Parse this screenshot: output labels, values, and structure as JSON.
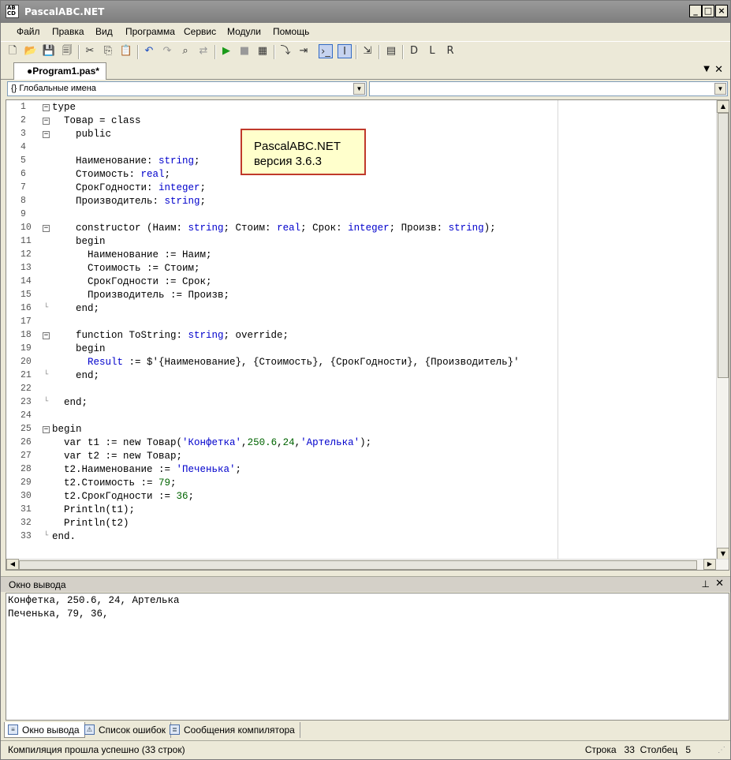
{
  "window": {
    "title": "PascalABC.NET",
    "icon_text": "AB\nCD"
  },
  "menu": [
    "Файл",
    "Правка",
    "Вид",
    "Программа",
    "Сервис",
    "Модули",
    "Помощь"
  ],
  "document_tab": "●Program1.pas*",
  "scope_combo": {
    "value": "Глобальные имена",
    "prefix": "{}"
  },
  "callout": {
    "line1": "PascalABC.NET",
    "line2": "версия 3.6.3"
  },
  "code_lines": [
    [
      [
        "type",
        "kw"
      ]
    ],
    [
      [
        "  Товар = class",
        "kw"
      ]
    ],
    [
      [
        "    public",
        "kw"
      ]
    ],
    [],
    [
      [
        "    Наименование: ",
        ""
      ],
      [
        "string",
        "ty"
      ],
      [
        ";",
        ""
      ]
    ],
    [
      [
        "    Стоимость: ",
        ""
      ],
      [
        "real",
        "ty"
      ],
      [
        ";",
        ""
      ]
    ],
    [
      [
        "    СрокГодности: ",
        ""
      ],
      [
        "integer",
        "ty"
      ],
      [
        ";",
        ""
      ]
    ],
    [
      [
        "    Производитель: ",
        ""
      ],
      [
        "string",
        "ty"
      ],
      [
        ";",
        ""
      ]
    ],
    [],
    [
      [
        "    constructor (Наим: ",
        ""
      ],
      [
        "string",
        "ty"
      ],
      [
        "; Стоим: ",
        ""
      ],
      [
        "real",
        "ty"
      ],
      [
        "; Срок: ",
        ""
      ],
      [
        "integer",
        "ty"
      ],
      [
        "; Произв: ",
        ""
      ],
      [
        "string",
        "ty"
      ],
      [
        ");",
        ""
      ]
    ],
    [
      [
        "    begin",
        ""
      ]
    ],
    [
      [
        "      Наименование := Наим;",
        ""
      ]
    ],
    [
      [
        "      Стоимость := Стоим;",
        ""
      ]
    ],
    [
      [
        "      СрокГодности := Срок;",
        ""
      ]
    ],
    [
      [
        "      Производитель := Произв;",
        ""
      ]
    ],
    [
      [
        "    end;",
        ""
      ]
    ],
    [],
    [
      [
        "    function ToString: ",
        ""
      ],
      [
        "string",
        "ty"
      ],
      [
        "; override;",
        ""
      ]
    ],
    [
      [
        "    begin",
        ""
      ]
    ],
    [
      [
        "      ",
        ""
      ],
      [
        "Result",
        "ty"
      ],
      [
        " := $'{Наименование}, {Стоимость}, {СрокГодности}, {Производитель}'",
        ""
      ]
    ],
    [
      [
        "    end;",
        ""
      ]
    ],
    [],
    [
      [
        "  end;",
        ""
      ]
    ],
    [],
    [
      [
        "begin",
        ""
      ]
    ],
    [
      [
        "  var t1 := new Товар(",
        ""
      ],
      [
        "'Конфетка'",
        "str"
      ],
      [
        ",",
        ""
      ],
      [
        "250.6",
        "num"
      ],
      [
        ",",
        ""
      ],
      [
        "24",
        "num"
      ],
      [
        ",",
        ""
      ],
      [
        "'Артелька'",
        "str"
      ],
      [
        ");",
        ""
      ]
    ],
    [
      [
        "  var t2 := new Товар;",
        ""
      ]
    ],
    [
      [
        "  t2.Наименование := ",
        ""
      ],
      [
        "'Печенька'",
        "str"
      ],
      [
        ";",
        ""
      ]
    ],
    [
      [
        "  t2.Стоимость := ",
        ""
      ],
      [
        "79",
        "num"
      ],
      [
        ";",
        ""
      ]
    ],
    [
      [
        "  t2.СрокГодности := ",
        ""
      ],
      [
        "36",
        "num"
      ],
      [
        ";",
        ""
      ]
    ],
    [
      [
        "  Println(t1);",
        ""
      ]
    ],
    [
      [
        "  Println(t2)",
        ""
      ]
    ],
    [
      [
        "end.",
        ""
      ]
    ]
  ],
  "fold_markers": {
    "1": "⊟",
    "2": "⊟",
    "3": "⊟",
    "10": "⊟",
    "16": "└",
    "18": "⊟",
    "21": "└",
    "23": "└",
    "25": "⊟",
    "33": "└"
  },
  "output": {
    "title": "Окно вывода",
    "lines": [
      "Конфетка, 250.6, 24, Артелька",
      "Печенька, 79, 36,"
    ]
  },
  "bottom_tabs": [
    "Окно вывода",
    "Список ошибок",
    "Сообщения компилятора"
  ],
  "status": {
    "message": "Компиляция прошла успешно (33 строк)",
    "row_label": "Строка",
    "row": "33",
    "col_label": "Столбец",
    "col": "5"
  }
}
